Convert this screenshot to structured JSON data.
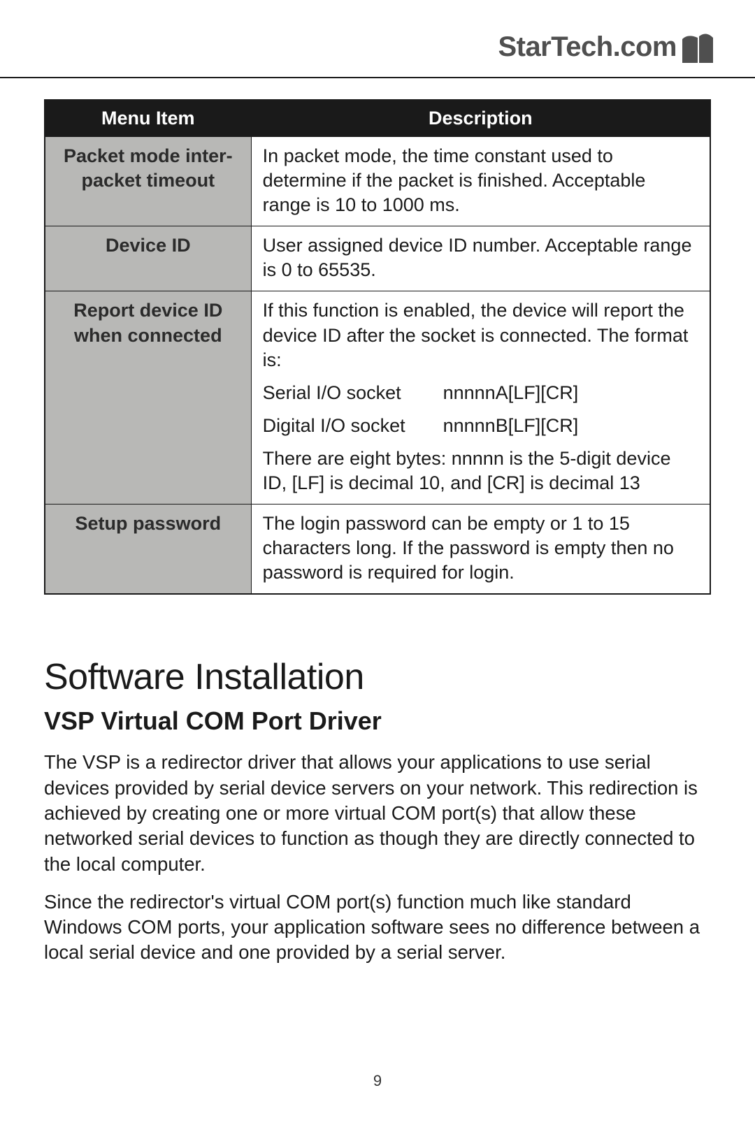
{
  "brand": "StarTech.com",
  "page_number": "9",
  "table": {
    "headers": {
      "col1": "Menu Item",
      "col2": "Description"
    },
    "rows": [
      {
        "item": "Packet mode inter-packet timeout",
        "desc": "In packet mode, the time constant used to determine if the packet is finished. Acceptable range is 10 to 1000 ms."
      },
      {
        "item": "Device ID",
        "desc": "User assigned device ID number. Acceptable range is 0 to 65535."
      },
      {
        "item": "Report device ID when connected",
        "desc_intro": "If this function is enabled, the device will report the device ID after the socket is connected. The format is:",
        "sock1_label": "Serial I/O socket",
        "sock1_fmt": "nnnnnA[LF][CR]",
        "sock2_label": "Digital I/O socket",
        "sock2_fmt": "nnnnnB[LF][CR]",
        "desc_outro": "There are eight bytes: nnnnn is the 5-digit device ID, [LF] is decimal 10, and [CR] is decimal 13"
      },
      {
        "item": "Setup password",
        "desc": "The login password can be empty or 1 to 15 characters long. If the password is empty then no password is required for login."
      }
    ]
  },
  "section_heading": "Software Installation",
  "sub_heading": "VSP Virtual COM Port Driver",
  "para1": "The VSP is a redirector driver that allows your applications to use serial devices provided by serial device servers on your network. This redirection is achieved by creating one or more virtual COM port(s) that allow these networked serial devices to function as though they are directly connected to the local computer.",
  "para2": "Since the redirector's virtual COM port(s) function much like standard Windows COM ports, your application software sees no difference between a local serial device and one provided by a serial server."
}
